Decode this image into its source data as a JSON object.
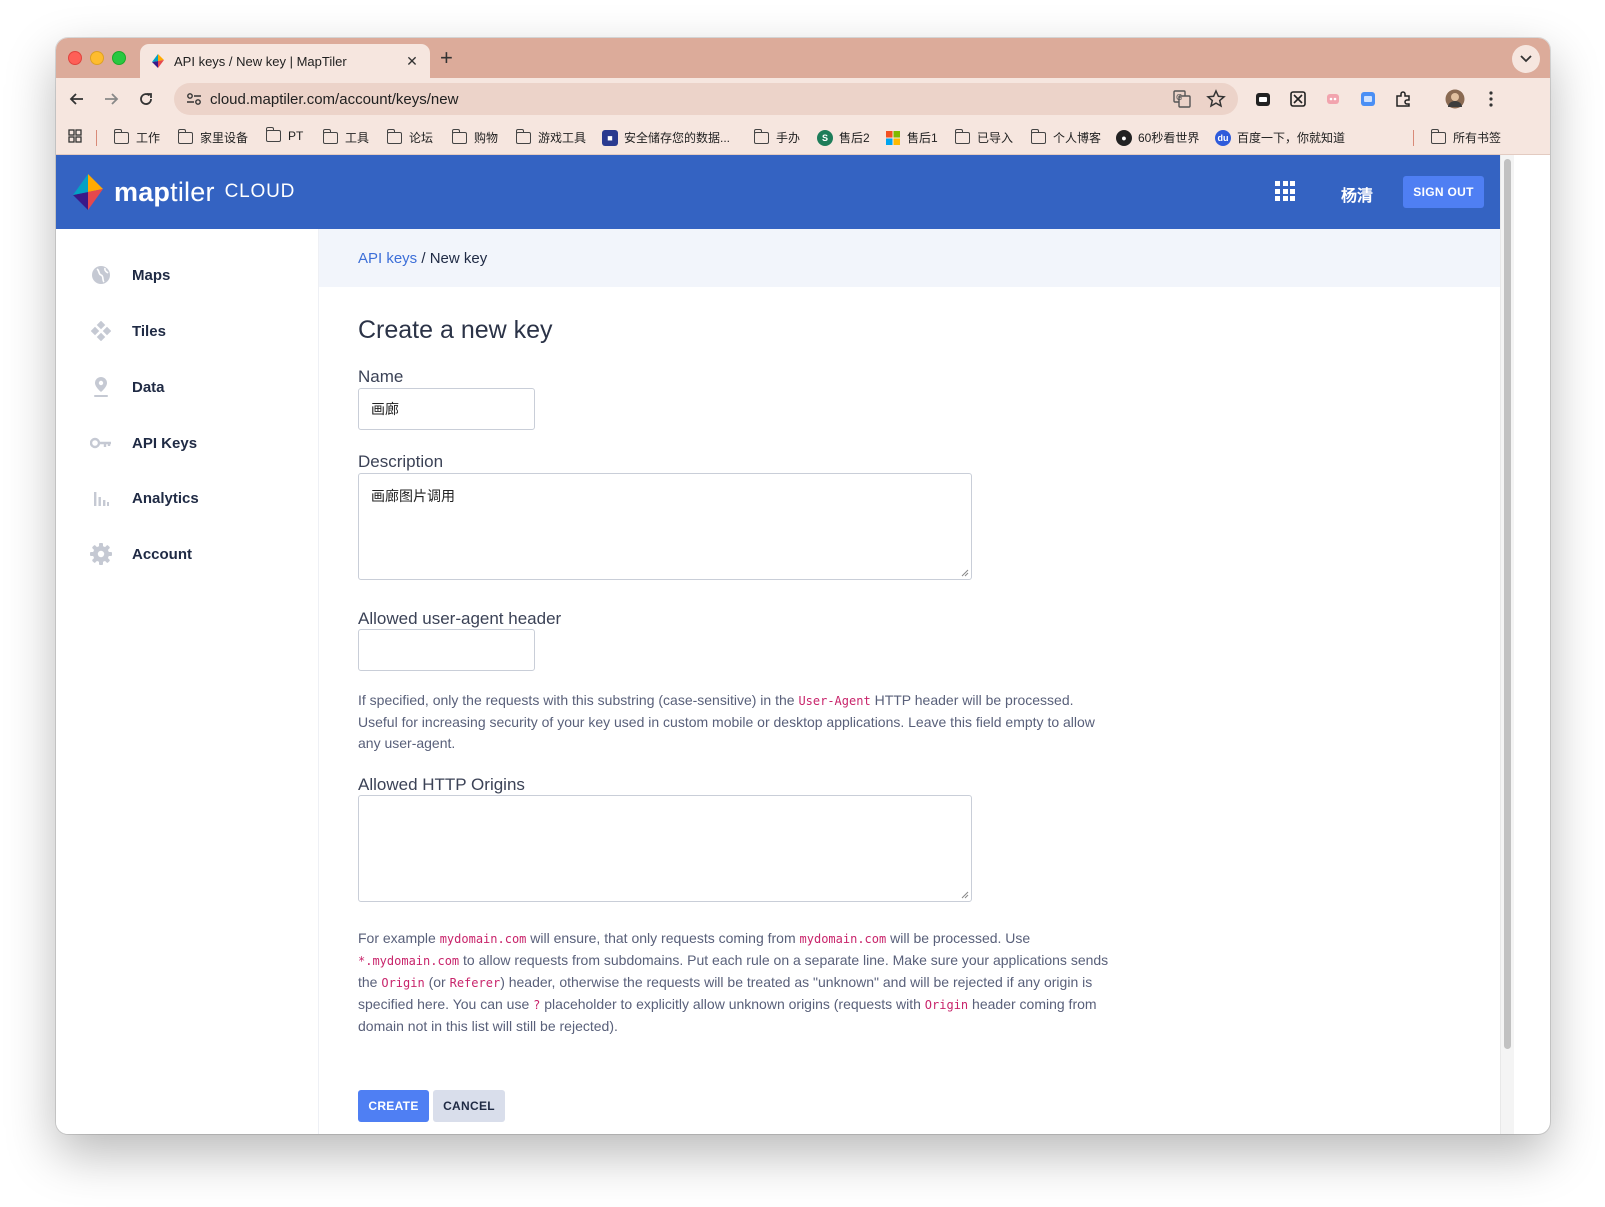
{
  "browser": {
    "tab_title": "API keys / New key | MapTiler",
    "url": "cloud.maptiler.com/account/keys/new",
    "bookmarks": [
      {
        "label": "工作",
        "icon": "folder-icon"
      },
      {
        "label": "家里设备",
        "icon": "folder-icon"
      },
      {
        "label": "PT",
        "icon": "folder-icon"
      },
      {
        "label": "工具",
        "icon": "folder-icon"
      },
      {
        "label": "论坛",
        "icon": "folder-icon"
      },
      {
        "label": "购物",
        "icon": "folder-icon"
      },
      {
        "label": "游戏工具",
        "icon": "folder-icon"
      },
      {
        "label": "安全储存您的数据...",
        "icon": "site-icon"
      },
      {
        "label": "手办",
        "icon": "folder-icon"
      },
      {
        "label": "售后2",
        "icon": "site-icon"
      },
      {
        "label": "售后1",
        "icon": "microsoft-icon"
      },
      {
        "label": "已导入",
        "icon": "folder-icon"
      },
      {
        "label": "个人博客",
        "icon": "folder-icon"
      },
      {
        "label": "60秒看世界",
        "icon": "site-icon"
      },
      {
        "label": "百度一下，你就知道",
        "icon": "baidu-icon"
      },
      {
        "label": "所有书签",
        "icon": "folder-icon"
      }
    ]
  },
  "header": {
    "logo_main": "map",
    "logo_tiler": "tiler",
    "logo_cloud": "CLOUD",
    "user_name": "杨清",
    "signout_label": "SIGN OUT"
  },
  "sidebar": {
    "items": [
      {
        "label": "Maps",
        "icon": "globe-icon"
      },
      {
        "label": "Tiles",
        "icon": "tiles-icon"
      },
      {
        "label": "Data",
        "icon": "pin-icon"
      },
      {
        "label": "API Keys",
        "icon": "key-icon"
      },
      {
        "label": "Analytics",
        "icon": "analytics-icon"
      },
      {
        "label": "Account",
        "icon": "gear-icon"
      }
    ]
  },
  "breadcrumb": {
    "link": "API keys",
    "separator": " / ",
    "current": "New key"
  },
  "form": {
    "title": "Create a new key",
    "name_label": "Name",
    "name_value": "画廊",
    "description_label": "Description",
    "description_value": "画廊图片调用",
    "useragent_label": "Allowed user-agent header",
    "useragent_value": "",
    "useragent_help_1": "If specified, only the requests with this substring (case-sensitive) in the ",
    "useragent_help_code": "User-Agent",
    "useragent_help_2": " HTTP header will be processed. Useful for increasing security of your key used in custom mobile or desktop applications. Leave this field empty to allow any user-agent.",
    "origins_label": "Allowed HTTP Origins",
    "origins_value": "",
    "origins_help": {
      "t1": "For example ",
      "c1": "mydomain.com",
      "t2": " will ensure, that only requests coming from ",
      "c2": "mydomain.com",
      "t3": " will be processed. Use ",
      "c3": "*.mydomain.com",
      "t4": " to allow requests from subdomains. Put each rule on a separate line. Make sure your applications sends the ",
      "c4": "Origin",
      "t5": " (or ",
      "c5": "Referer",
      "t6": ") header, otherwise the requests will be treated as \"unknown\" and will be rejected if any origin is specified here. You can use ",
      "c6": "?",
      "t7": " placeholder to explicitly allow unknown origins (requests with ",
      "c7": "Origin",
      "t8": " header coming from domain not in this list will still be rejected)."
    },
    "create_label": "CREATE",
    "cancel_label": "CANCEL"
  },
  "colors": {
    "header_bg": "#3463c2",
    "primary_button": "#4f7ff3",
    "code_text": "#c8246b",
    "breadcrumb_bg": "#f2f5fb",
    "browser_frame": "#dcab9a"
  }
}
